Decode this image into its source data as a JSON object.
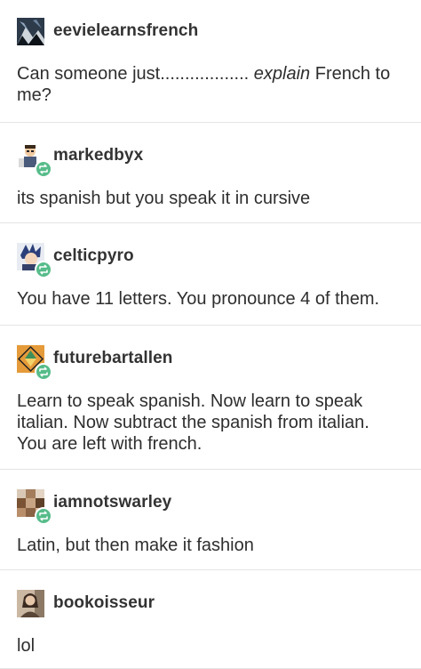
{
  "posts": [
    {
      "username": "eevielearnsfrench",
      "text_before": "Can someone just.................. ",
      "text_emph": "explain",
      "text_after": " French to me?",
      "reblog": false,
      "avatar_icon": "mountain-art-avatar-icon"
    },
    {
      "username": "markedbyx",
      "text": "its spanish but you speak it in cursive",
      "reblog": true,
      "avatar_icon": "cartoon-character-avatar-icon"
    },
    {
      "username": "celticpyro",
      "text": "You have 11 letters. You pronounce 4 of them.",
      "reblog": true,
      "avatar_icon": "anime-character-avatar-icon"
    },
    {
      "username": "futurebartallen",
      "text": "Learn to speak spanish. Now learn to speak italian. Now subtract the spanish from italian. You are left with french.",
      "reblog": true,
      "avatar_icon": "triforce-diamond-avatar-icon"
    },
    {
      "username": "iamnotswarley",
      "text": "Latin, but then make it fashion",
      "reblog": true,
      "avatar_icon": "pixel-mosaic-avatar-icon"
    },
    {
      "username": "bookoisseur",
      "text": "lol",
      "reblog": false,
      "avatar_icon": "person-photo-avatar-icon"
    }
  ],
  "colors": {
    "reblog_badge": "#56bc8a",
    "divider": "#e4e4e4",
    "text": "#2e2e2e"
  }
}
